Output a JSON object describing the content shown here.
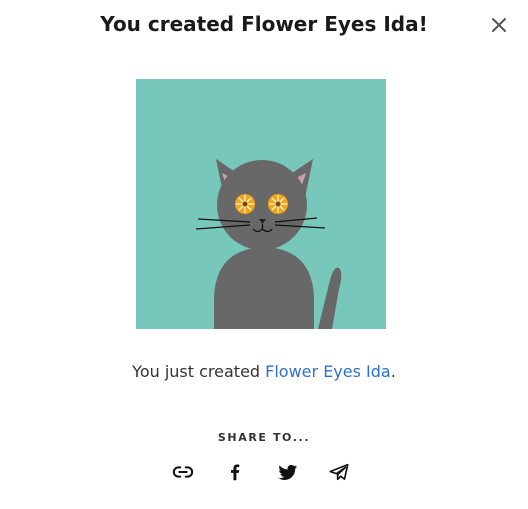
{
  "modal": {
    "title": "You created Flower Eyes Ida!",
    "close_icon": "close-icon"
  },
  "artwork": {
    "background_color": "#77c8bb",
    "cat_color": "#686868",
    "ear_inner_color": "#c7a1b3",
    "flower_eye_color": "#f2a516"
  },
  "caption": {
    "prefix": "You just created ",
    "link_text": "Flower Eyes Ida",
    "suffix": ".",
    "link_color": "#2f6fd1"
  },
  "share": {
    "label": "SHARE TO...",
    "buttons": [
      {
        "icon": "link-icon"
      },
      {
        "icon": "facebook-icon"
      },
      {
        "icon": "twitter-icon"
      },
      {
        "icon": "telegram-icon"
      }
    ]
  }
}
